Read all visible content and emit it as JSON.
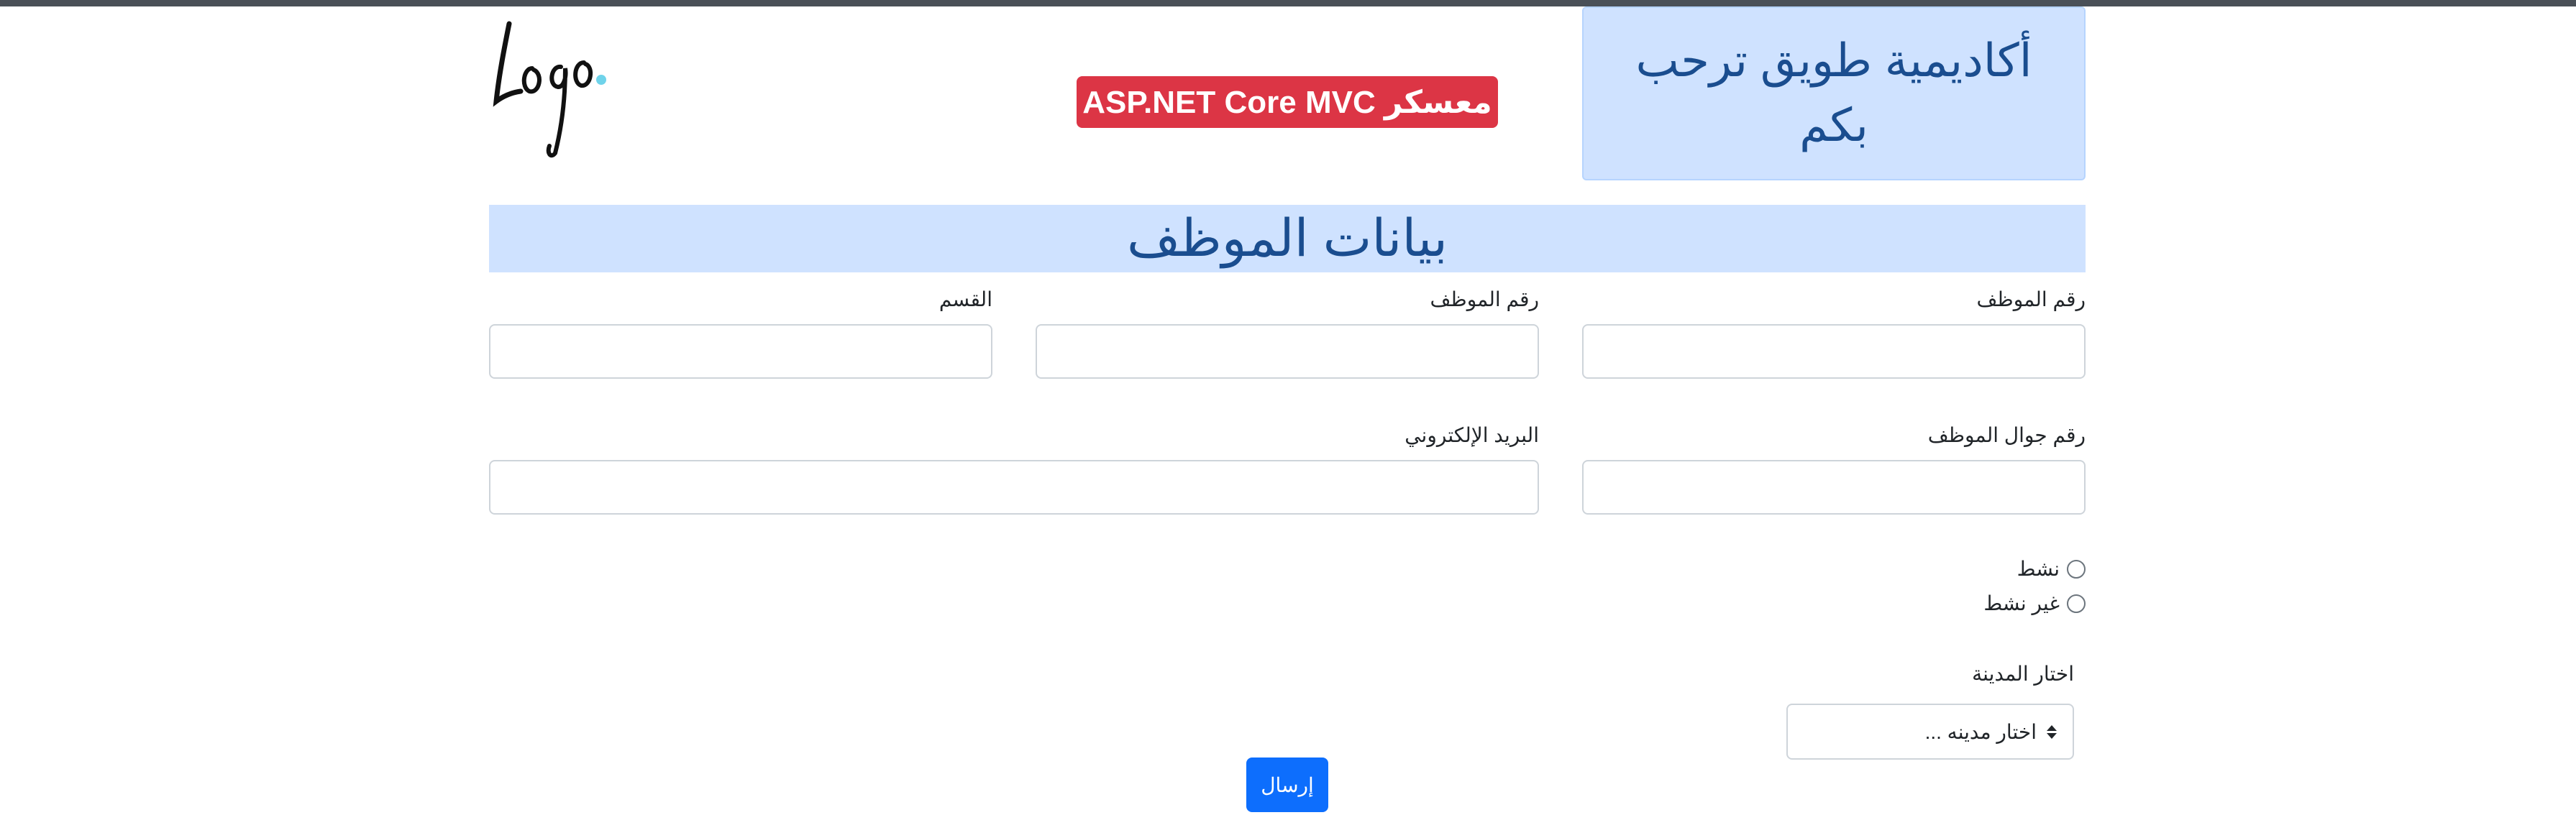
{
  "header": {
    "academy_title": "أكاديمية طويق ترحب بكم",
    "bootcamp_badge": "معسكر ASP.NET Core MVC",
    "logo_text": "Logo"
  },
  "section": {
    "heading": "بيانات الموظف"
  },
  "form": {
    "employee_number_label": "رقم الموظف",
    "employee_number_2_label": "رقم الموظف",
    "department_label": "القسم",
    "mobile_label": "رقم جوال الموظف",
    "email_label": "البريد الإلكتروني",
    "status_options": [
      "نشط",
      "غير نشط"
    ],
    "city_label": "اختار المدينة",
    "city_selected": "اختار مدينه ...",
    "submit_label": "إرسال"
  },
  "colors": {
    "accent": "#cfe2ff",
    "heading_text": "#1a4d8f",
    "badge": "#dc3545",
    "primary_button": "#0d6efd",
    "logo_dot": "#6fd3ea"
  }
}
